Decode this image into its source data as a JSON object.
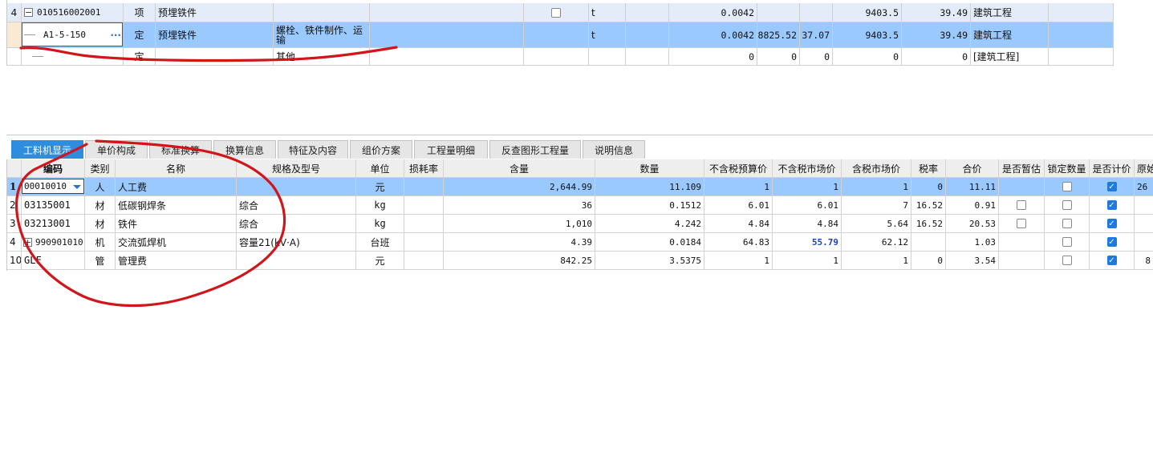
{
  "top_grid": {
    "rows": [
      {
        "row_no": "4",
        "expander": "−",
        "code": "010516002001",
        "type": "项",
        "name": "预埋铁件",
        "feature": "",
        "unit": "t",
        "qty": "0.0042",
        "price1": "",
        "price2": "",
        "price3": "9403.5",
        "total": "39.49",
        "category": "建筑工程",
        "checkbox": false
      },
      {
        "row_no": "",
        "code": "A1-5-150",
        "ellipsis": "···",
        "type": "定",
        "name": "预埋铁件",
        "feature": "螺栓、铁件制作、运输",
        "unit": "t",
        "qty": "0.0042",
        "price1": "8825.52",
        "price2": "37.07",
        "price3": "9403.5",
        "total": "39.49",
        "category": "建筑工程"
      },
      {
        "row_no": "",
        "code": "",
        "type": "定",
        "name": "",
        "feature": "其他",
        "unit": "",
        "qty": "0",
        "price1": "0",
        "price2": "0",
        "price3": "0",
        "total": "0",
        "category": "[建筑工程]"
      }
    ]
  },
  "tabs": [
    {
      "label": "工料机显示",
      "active": true
    },
    {
      "label": "单价构成",
      "active": false
    },
    {
      "label": "标准换算",
      "active": false
    },
    {
      "label": "换算信息",
      "active": false
    },
    {
      "label": "特征及内容",
      "active": false
    },
    {
      "label": "组价方案",
      "active": false
    },
    {
      "label": "工程量明细",
      "active": false
    },
    {
      "label": "反查图形工程量",
      "active": false
    },
    {
      "label": "说明信息",
      "active": false
    }
  ],
  "bottom_grid": {
    "headers": [
      "编码",
      "类别",
      "名称",
      "规格及型号",
      "单位",
      "损耗率",
      "含量",
      "数量",
      "不含税预算价",
      "不含税市场价",
      "含税市场价",
      "税率",
      "合价",
      "是否暂估",
      "锁定数量",
      "是否计价",
      "原始"
    ],
    "rows": [
      {
        "no": "1",
        "code": "00010010",
        "cat": "人",
        "name": "人工费",
        "spec": "",
        "unit": "元",
        "loss": "",
        "content": "2,644.99",
        "qty": "11.109",
        "p_budget": "1",
        "p_market": "1",
        "p_tax": "1",
        "rate": "0",
        "amount": "11.11",
        "est": null,
        "lock": false,
        "price": true,
        "orig": "26"
      },
      {
        "no": "2",
        "code": "03135001",
        "cat": "材",
        "name": "低碳钢焊条",
        "spec": "综合",
        "unit": "kg",
        "loss": "",
        "content": "36",
        "qty": "0.1512",
        "p_budget": "6.01",
        "p_market": "6.01",
        "p_tax": "7",
        "rate": "16.52",
        "amount": "0.91",
        "est": false,
        "lock": false,
        "price": true,
        "orig": ""
      },
      {
        "no": "3",
        "code": "03213001",
        "cat": "材",
        "name": "铁件",
        "spec": "综合",
        "unit": "kg",
        "loss": "",
        "content": "1,010",
        "qty": "4.242",
        "p_budget": "4.84",
        "p_market": "4.84",
        "p_tax": "5.64",
        "rate": "16.52",
        "amount": "20.53",
        "est": false,
        "lock": false,
        "price": true,
        "orig": ""
      },
      {
        "no": "4",
        "code": "990901010",
        "expander": "+",
        "cat": "机",
        "name": "交流弧焊机",
        "spec": "容量21(kV·A)",
        "unit": "台班",
        "loss": "",
        "content": "4.39",
        "qty": "0.0184",
        "p_budget": "64.83",
        "p_market": "55.79",
        "p_tax": "62.12",
        "rate": "",
        "amount": "1.03",
        "est": null,
        "lock": false,
        "price": true,
        "orig": "",
        "market_highlight": true
      },
      {
        "no": "10",
        "code": "GLF",
        "cat": "管",
        "name": "管理费",
        "spec": "",
        "unit": "元",
        "loss": "",
        "content": "842.25",
        "qty": "3.5375",
        "p_budget": "1",
        "p_market": "1",
        "p_tax": "1",
        "rate": "0",
        "amount": "3.54",
        "est": null,
        "lock": false,
        "price": true,
        "orig": "8"
      }
    ]
  },
  "colors": {
    "selected_row": "#99c9ff",
    "active_tab": "#2f8ddf",
    "annotation": "#d0161b",
    "highlight_value": "#1a3fbf"
  }
}
